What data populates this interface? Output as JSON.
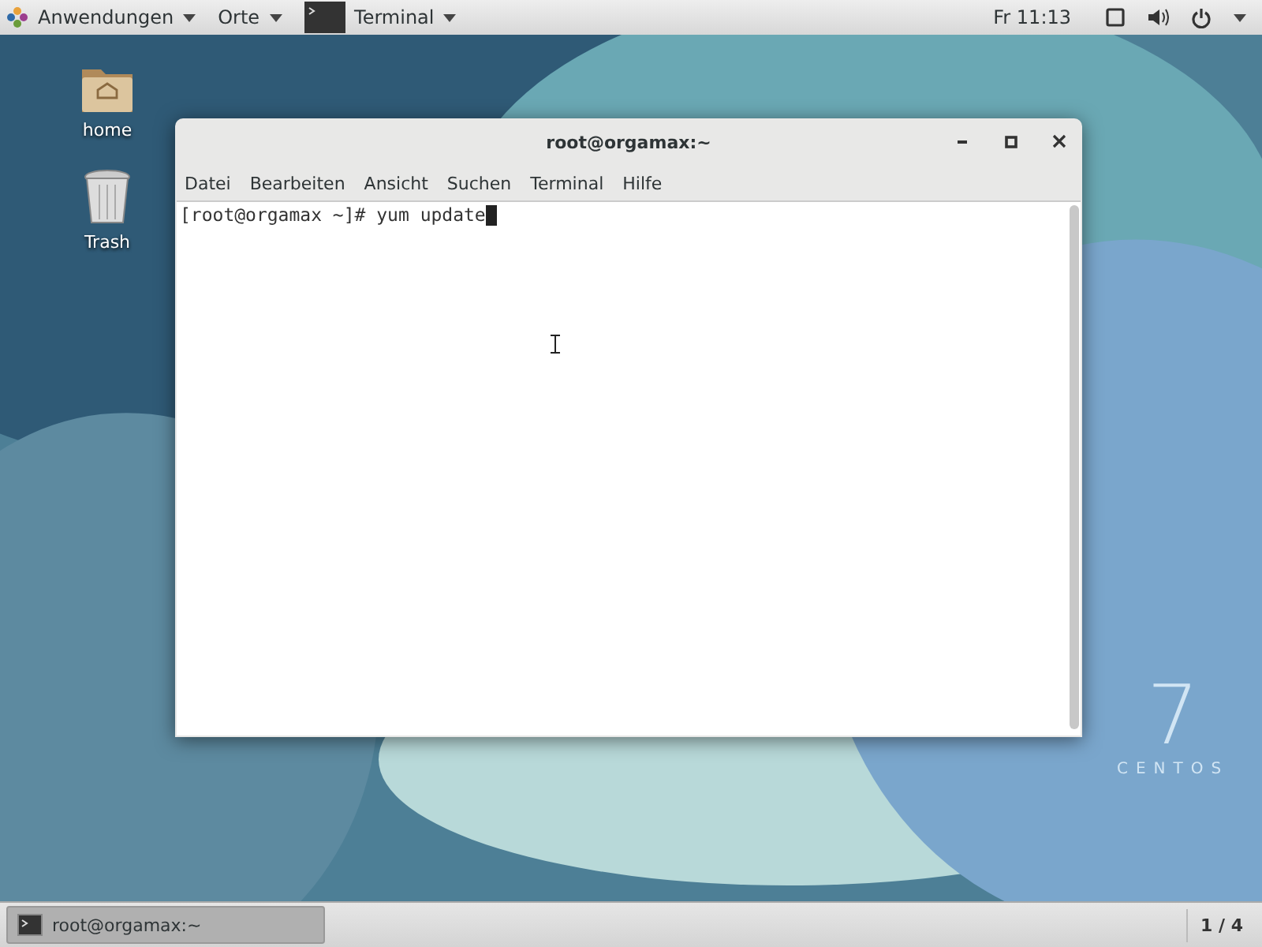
{
  "top_bar": {
    "menus": [
      {
        "label": "Anwendungen",
        "kind": "apps"
      },
      {
        "label": "Orte",
        "kind": "plain"
      },
      {
        "label": "Terminal",
        "kind": "app"
      }
    ],
    "clock": "Fr 11:13"
  },
  "desktop_icons": [
    {
      "label": "home",
      "kind": "folder"
    },
    {
      "label": "Trash",
      "kind": "trash"
    }
  ],
  "wallpaper": {
    "version": "7",
    "brand": "CENTOS"
  },
  "window": {
    "title": "root@orgamax:~",
    "menu": [
      "Datei",
      "Bearbeiten",
      "Ansicht",
      "Suchen",
      "Terminal",
      "Hilfe"
    ],
    "prompt": "[root@orgamax ~]# yum update"
  },
  "taskbar": {
    "tasks": [
      {
        "label": "root@orgamax:~",
        "selected": true
      }
    ],
    "workspace": "1 / 4"
  }
}
